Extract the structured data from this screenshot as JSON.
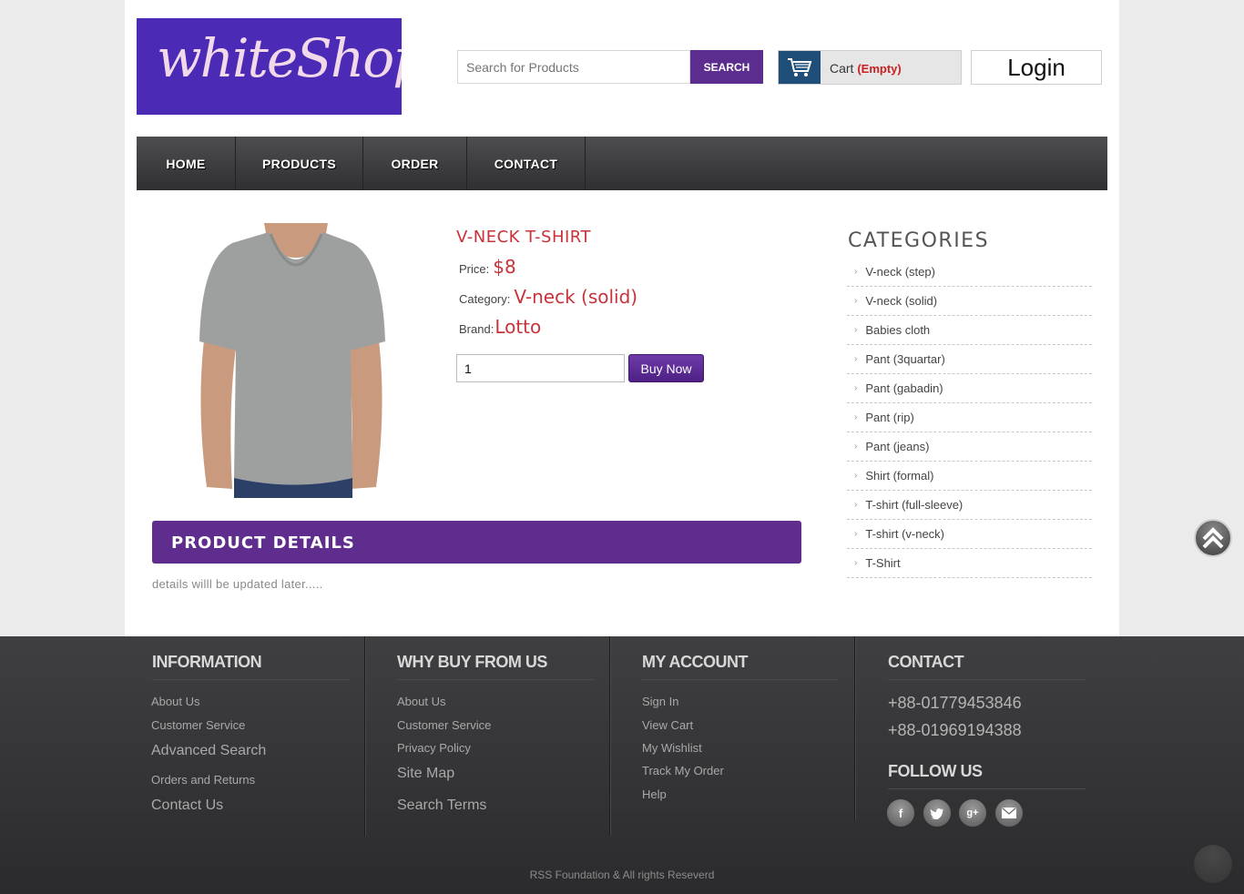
{
  "logo": {
    "text": "whiteShop"
  },
  "search": {
    "placeholder": "Search for Products",
    "button_label": "SEARCH"
  },
  "cart": {
    "label": "Cart",
    "status": "(Empty)"
  },
  "login": {
    "label": "Login"
  },
  "nav": {
    "items": [
      "HOME",
      "PRODUCTS",
      "ORDER",
      "CONTACT"
    ]
  },
  "product": {
    "title": "V-NECK T-SHIRT",
    "price_label": "Price:",
    "price": "$8",
    "category_label": "Category:",
    "category": "V-neck (solid)",
    "brand_label": "Brand:",
    "brand": "Lotto",
    "quantity": "1",
    "buy_label": "Buy Now",
    "details_heading": "PRODUCT DETAILS",
    "details_text": "details willl be updated later....."
  },
  "categories": {
    "title": "CATEGORIES",
    "items": [
      "V-neck (step)",
      "V-neck (solid)",
      "Babies cloth",
      "Pant (3quartar)",
      "Pant (gabadin)",
      "Pant (rip)",
      "Pant (jeans)",
      "Shirt (formal)",
      "T-shirt (full-sleeve)",
      "T-shirt (v-neck)",
      "T-Shirt"
    ]
  },
  "footer": {
    "information": {
      "heading": "INFORMATION",
      "links": [
        "About Us",
        "Customer Service",
        "Advanced Search",
        "Orders and Returns",
        "Contact Us"
      ]
    },
    "why_buy": {
      "heading": "WHY BUY FROM US",
      "links": [
        "About Us",
        "Customer Service",
        "Privacy Policy",
        "Site Map",
        "Search Terms"
      ]
    },
    "my_account": {
      "heading": "MY ACCOUNT",
      "links": [
        "Sign In",
        "View Cart",
        "My Wishlist",
        "Track My Order",
        "Help"
      ]
    },
    "contact": {
      "heading": "CONTACT",
      "phones": [
        "+88-01779453846",
        "+88-01969194388"
      ],
      "follow_heading": "FOLLOW US",
      "social_icons": [
        "facebook-icon",
        "twitter-icon",
        "google-plus-icon",
        "email-icon"
      ]
    },
    "copyright": "RSS Foundation & All rights Reseverd"
  },
  "colors": {
    "brand": "#4b2bb5",
    "accent": "#5f2d8d",
    "price": "#c8323a",
    "cart_status": "#cc1f1f"
  }
}
